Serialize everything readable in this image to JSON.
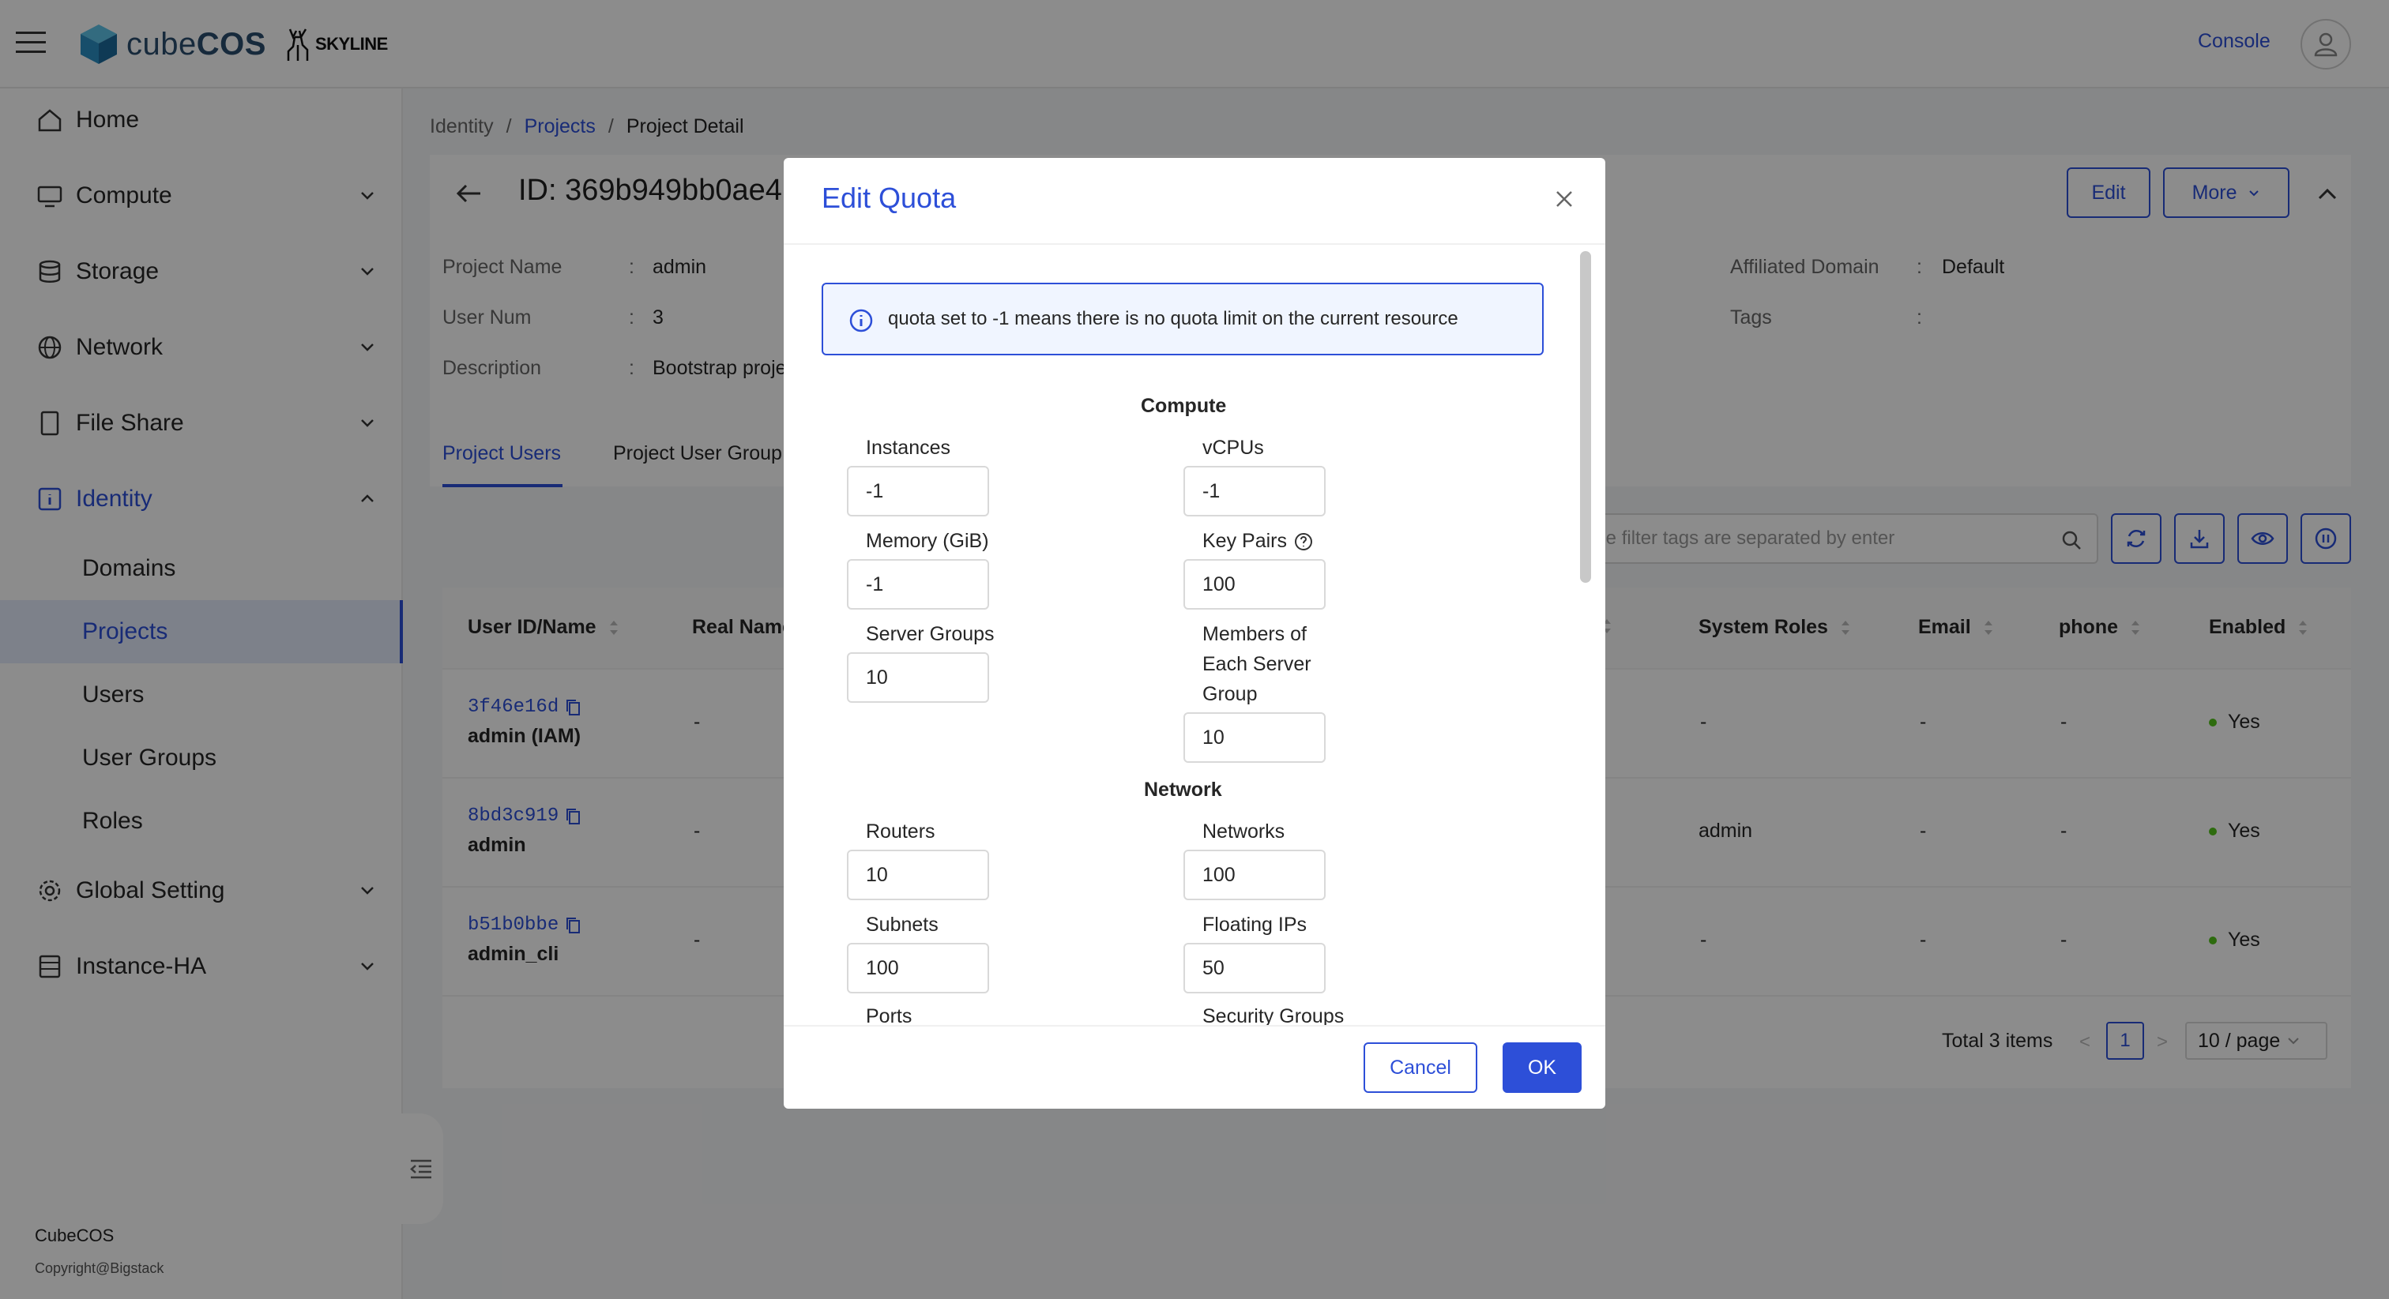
{
  "header": {
    "logo_text_light": "cube",
    "logo_text_bold": "COS",
    "partner_logo": "SKYLINE",
    "console_label": "Console"
  },
  "sidebar": {
    "items": [
      {
        "label": "Home",
        "icon": "home-icon"
      },
      {
        "label": "Compute",
        "icon": "monitor-icon"
      },
      {
        "label": "Storage",
        "icon": "database-icon"
      },
      {
        "label": "Network",
        "icon": "globe-icon"
      },
      {
        "label": "File Share",
        "icon": "file-icon"
      },
      {
        "label": "Identity",
        "icon": "identity-icon"
      },
      {
        "label": "Global Setting",
        "icon": "gear-icon"
      },
      {
        "label": "Instance-HA",
        "icon": "list-icon"
      }
    ],
    "identity_subitems": [
      "Domains",
      "Projects",
      "Users",
      "User Groups",
      "Roles"
    ],
    "selected_subitem": "Projects",
    "footer_brand": "CubeCOS",
    "footer_copyright": "Copyright@Bigstack"
  },
  "breadcrumb": {
    "root": "Identity",
    "separator": "/",
    "parent": "Projects",
    "current": "Project Detail"
  },
  "detail": {
    "id_label": "ID:",
    "id_value": "369b949bb0ae4",
    "edit_label": "Edit",
    "more_label": "More",
    "fields": {
      "project_name_label": "Project Name",
      "project_name_value": "admin",
      "user_num_label": "User Num",
      "user_num_value": "3",
      "description_label": "Description",
      "description_value": "Bootstrap proje",
      "affiliated_domain_label": "Affiliated Domain",
      "affiliated_domain_value": "Default",
      "tags_label": "Tags",
      "tags_value": "",
      "separator": ":"
    },
    "tabs": [
      "Project Users",
      "Project User Group"
    ]
  },
  "toolbar": {
    "search_placeholder": "ple filter tags are separated by enter"
  },
  "table": {
    "columns": [
      "User ID/Name",
      "Real Name",
      "System Roles",
      "Email",
      "phone",
      "Enabled"
    ],
    "rows": [
      {
        "id": "3f46e16d",
        "name": "admin (IAM)",
        "real_name": "-",
        "system_roles": "-",
        "email": "-",
        "phone": "-",
        "enabled": "Yes"
      },
      {
        "id": "8bd3c919",
        "name": "admin",
        "real_name": "-",
        "system_roles": "admin",
        "email": "-",
        "phone": "-",
        "enabled": "Yes"
      },
      {
        "id": "b51b0bbe",
        "name": "admin_cli",
        "real_name": "-",
        "system_roles": "-",
        "email": "-",
        "phone": "-",
        "enabled": "Yes"
      }
    ],
    "pagination": {
      "total": "Total 3 items",
      "prev": "<",
      "next": ">",
      "current_page": "1",
      "page_size": "10 / page"
    }
  },
  "modal": {
    "title": "Edit Quota",
    "info": "quota set to -1 means there is no quota limit on the current resource",
    "sections": {
      "compute": "Compute",
      "network": "Network"
    },
    "fields": {
      "instances_label": "Instances",
      "instances_value": "-1",
      "vcpus_label": "vCPUs",
      "vcpus_value": "-1",
      "memory_label": "Memory (GiB)",
      "memory_value": "-1",
      "keypairs_label": "Key Pairs",
      "keypairs_value": "100",
      "server_groups_label": "Server Groups",
      "server_groups_value": "10",
      "members_label_1": "Members of",
      "members_label_2": "Each Server",
      "members_label_3": "Group",
      "members_value": "10",
      "routers_label": "Routers",
      "routers_value": "10",
      "networks_label": "Networks",
      "networks_value": "100",
      "subnets_label": "Subnets",
      "subnets_value": "100",
      "floating_ips_label": "Floating IPs",
      "floating_ips_value": "50",
      "ports_label": "Ports",
      "security_groups_label": "Security Groups"
    },
    "cancel_label": "Cancel",
    "ok_label": "OK"
  },
  "colors": {
    "accent": "#2d4fd8",
    "status_ok": "#52c41a"
  }
}
